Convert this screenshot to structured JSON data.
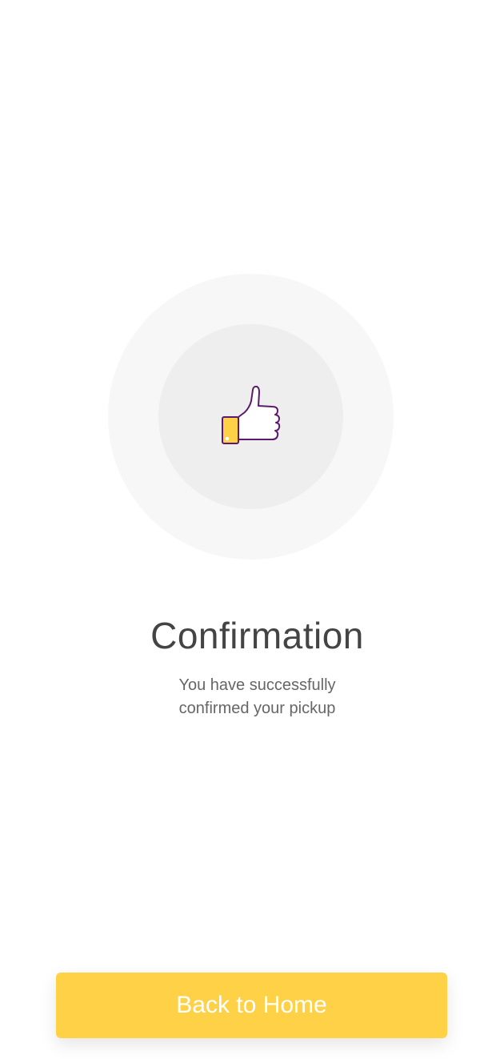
{
  "confirmation": {
    "title": "Confirmation",
    "message_line1": "You have successfully",
    "message_line2": "confirmed your pickup"
  },
  "icon": {
    "name": "thumbs-up-icon",
    "cuff_color": "#ffd146",
    "outline_color": "#5c1a6e"
  },
  "button": {
    "label": "Back to Home",
    "color": "#ffd146"
  }
}
